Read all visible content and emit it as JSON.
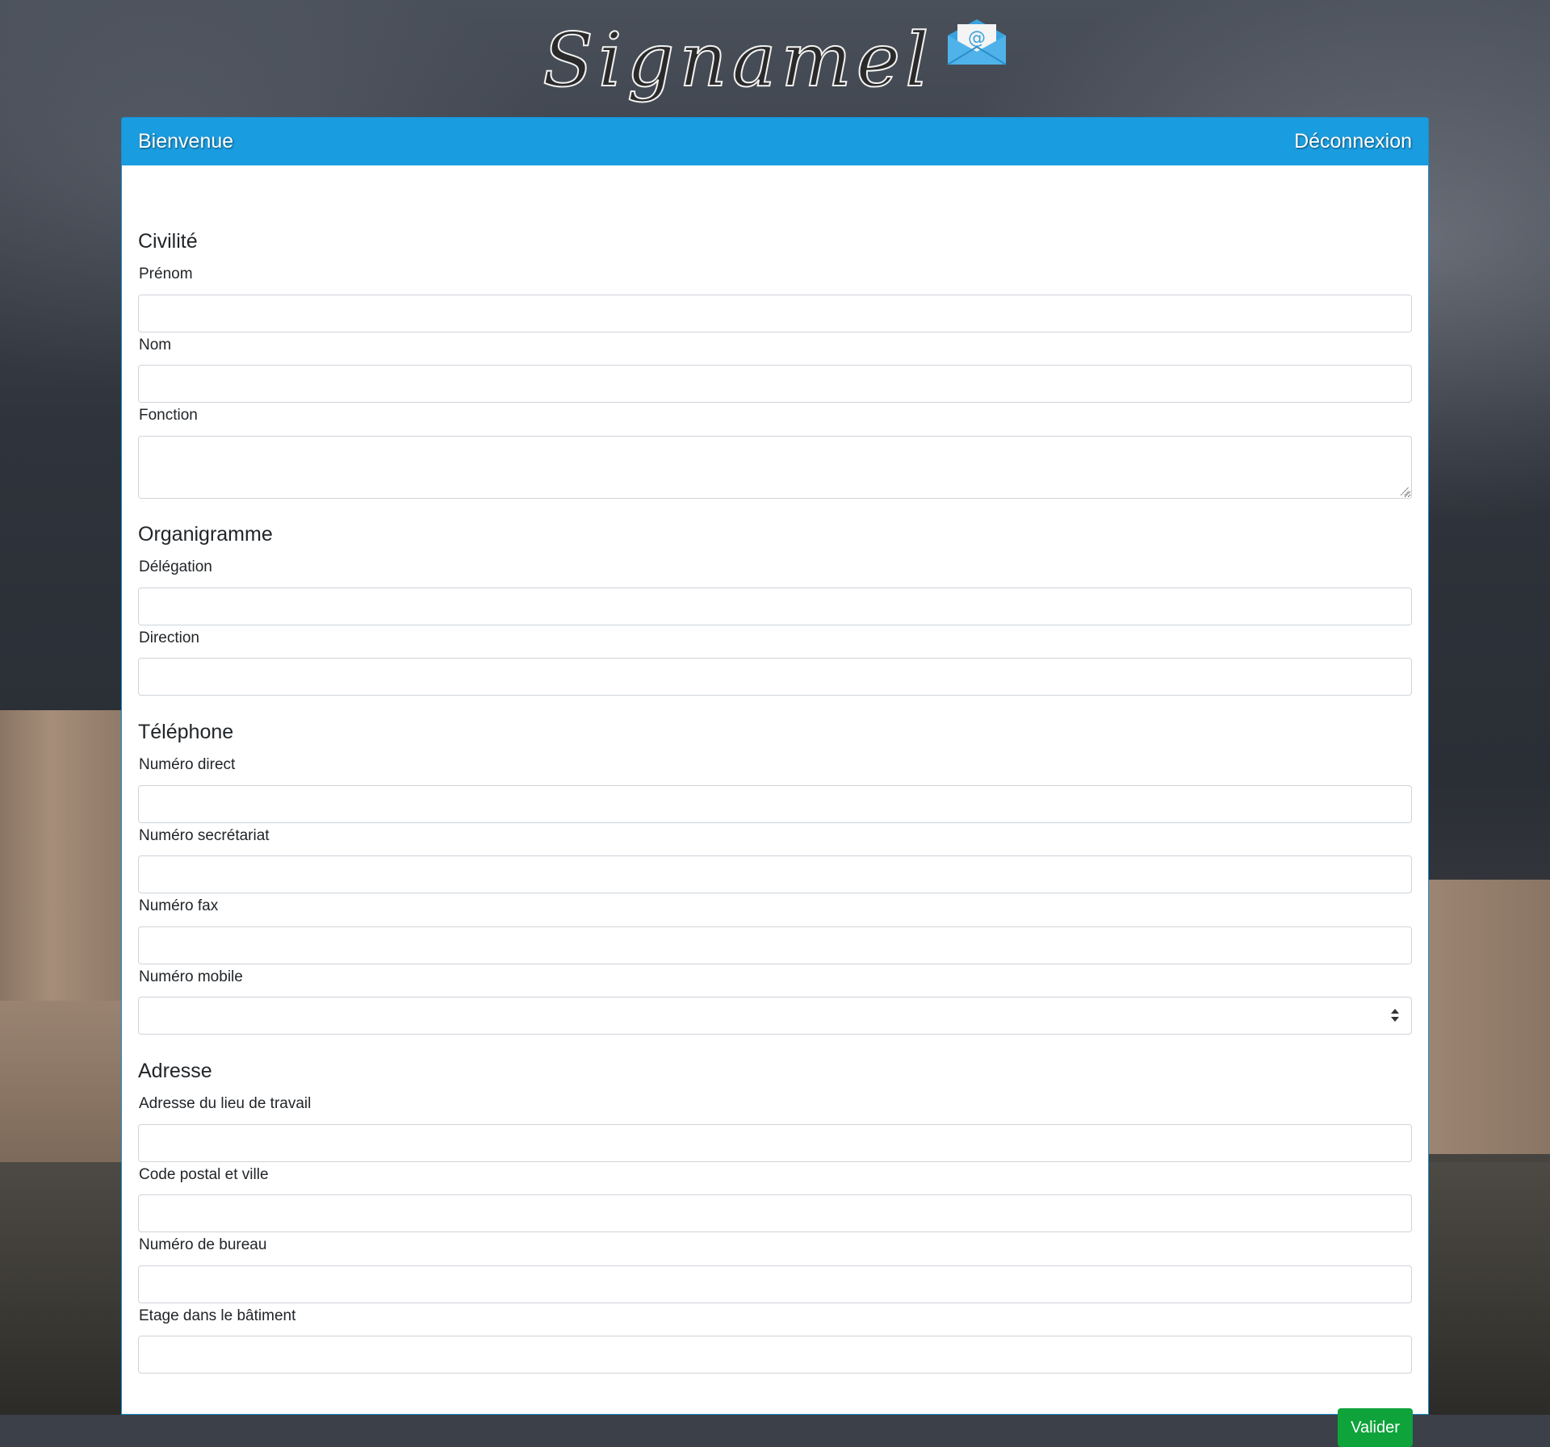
{
  "logo": {
    "text": "Signamel",
    "icon": "envelope-at-icon"
  },
  "header": {
    "title": "Bienvenue",
    "logout": "Déconnexion"
  },
  "sections": {
    "civilite": {
      "title": "Civilité",
      "prenom_label": "Prénom",
      "nom_label": "Nom",
      "fonction_label": "Fonction"
    },
    "organigramme": {
      "title": "Organigramme",
      "delegation_label": "Délégation",
      "direction_label": "Direction"
    },
    "telephone": {
      "title": "Téléphone",
      "direct_label": "Numéro direct",
      "secretariat_label": "Numéro secrétariat",
      "fax_label": "Numéro fax",
      "mobile_label": "Numéro mobile"
    },
    "adresse": {
      "title": "Adresse",
      "lieu_label": "Adresse du lieu de travail",
      "cp_ville_label": "Code postal et ville",
      "bureau_label": "Numéro de bureau",
      "etage_label": "Etage dans le bâtiment"
    }
  },
  "values": {
    "prenom": "",
    "nom": "",
    "fonction": "",
    "delegation": "",
    "direction": "",
    "direct": "",
    "secretariat": "",
    "fax": "",
    "mobile": "",
    "lieu": "",
    "cp_ville": "",
    "bureau": "",
    "etage": ""
  },
  "submit_label": "Valider",
  "colors": {
    "header": "#1a9de0",
    "submit": "#0fa33b"
  }
}
